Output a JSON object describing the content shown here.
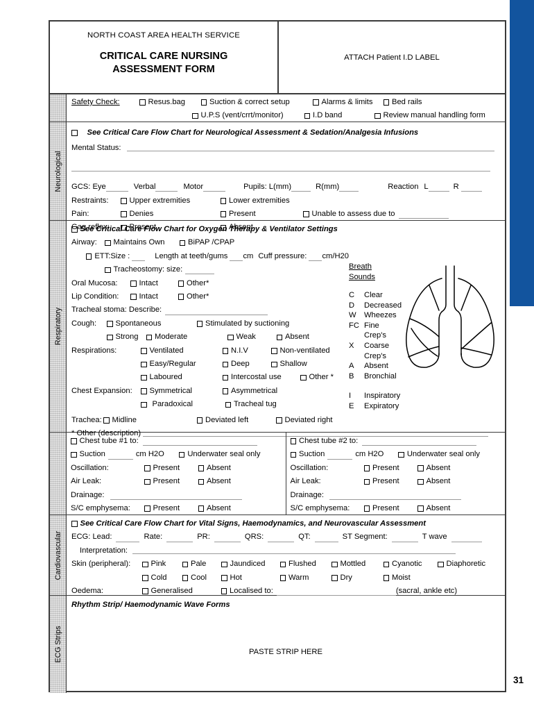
{
  "page": {
    "side_title": "CRITICAL CARE NURSING ASSESSMENT FORM",
    "page_number": "31",
    "accent_color": "#12549e"
  },
  "header": {
    "organisation": "NORTH COAST AREA HEALTH SERVICE",
    "title_line1": "CRITICAL CARE NURSING",
    "title_line2": "ASSESSMENT FORM",
    "attach_label": "ATTACH Patient I.D LABEL"
  },
  "safety": {
    "label": "Safety Check:",
    "row1": [
      "Resus.bag",
      "Suction & correct setup",
      "Alarms & limits",
      "Bed rails"
    ],
    "row2": [
      "U.P.S (vent/crrt/monitor)",
      "I.D band",
      "Review manual handling form"
    ]
  },
  "neurological": {
    "tab_label": "Neurological",
    "flowchart_note": "See Critical Care Flow Chart for Neurological Assessment & Sedation/Analgesia Infusions",
    "mental_status_label": "Mental Status:",
    "gcs_label": "GCS: Eye",
    "gcs_verbal": "Verbal",
    "gcs_motor": "Motor",
    "pupils_label": "Pupils: L(mm)",
    "pupils_r": "R(mm)",
    "reaction_label": "Reaction",
    "reaction_l": "L",
    "reaction_r": "R",
    "restraints_label": "Restraints:",
    "restraints_opts": [
      "Upper extremities",
      "Lower extremities"
    ],
    "pain_label": "Pain:",
    "pain_opts": [
      "Denies",
      "Present",
      "Unable to assess due to"
    ],
    "gag_label": "Gag reflex:",
    "gag_opts": [
      "Present",
      "Absent"
    ]
  },
  "respiratory": {
    "tab_label": "Respiratory",
    "flowchart_note": "See Critical Care Flow Chart for Oxygen Therapy & Ventilator Settings",
    "airway_label": "Airway:",
    "airway_opts": [
      "Maintains Own",
      "BiPAP /CPAP"
    ],
    "ett_label": "ETT:",
    "ett_size_label": "Size :",
    "ett_length_label": "Length at teeth/gums",
    "ett_length_unit": "cm",
    "cuff_label": "Cuff pressure:",
    "cuff_unit": "cm/H20",
    "trach_label": "Tracheostomy: size:",
    "oral_mucosa_label": "Oral Mucosa:",
    "oral_mucosa_opts": [
      "Intact",
      "Other*"
    ],
    "lip_label": "Lip Condition:",
    "lip_opts": [
      "Intact",
      "Other*"
    ],
    "stoma_label": "Tracheal stoma:  Describe:",
    "cough_label": "Cough:",
    "cough_opts": [
      "Spontaneous",
      "Stimulated by suctioning"
    ],
    "cough_strength": [
      "Strong",
      "Moderate",
      "Weak",
      "Absent"
    ],
    "resp_label": "Respirations:",
    "resp_row1": [
      "Ventilated",
      "N.I.V",
      "Non-ventilated"
    ],
    "resp_row2": [
      "Easy/Regular",
      "Deep",
      "Shallow"
    ],
    "resp_row3": [
      "Laboured",
      "Intercostal use",
      "Other *"
    ],
    "chest_exp_label": "Chest Expansion:",
    "chest_exp_row1": [
      "Symmetrical",
      "Asymmetrical"
    ],
    "chest_exp_row2": [
      "Paradoxical",
      "Tracheal tug"
    ],
    "trachea_label": "Trachea:",
    "trachea_opts": [
      "Midline",
      "Deviated left",
      "Deviated right"
    ],
    "other_desc_label": "* Other (description)",
    "breath_sounds": {
      "title_line1": "Breath",
      "title_line2": "Sounds",
      "items": [
        {
          "key": "C",
          "label": "Clear"
        },
        {
          "key": "D",
          "label": "Decreased"
        },
        {
          "key": "W",
          "label": "Wheezes"
        },
        {
          "key": "FC",
          "label": "Fine"
        },
        {
          "key": "",
          "label": "Crep's"
        },
        {
          "key": "X",
          "label": "Coarse"
        },
        {
          "key": "",
          "label": "Crep's"
        },
        {
          "key": "A",
          "label": "Absent"
        },
        {
          "key": "B",
          "label": "Bronchial"
        }
      ],
      "items2": [
        {
          "key": "I",
          "label": "Inspiratory"
        },
        {
          "key": "E",
          "label": "Expiratory"
        }
      ]
    }
  },
  "chest_tubes": [
    {
      "title": "Chest tube #1 to:",
      "suction_label": "Suction",
      "suction_unit": "cm H2O",
      "underwater": "Underwater seal only",
      "oscillation_label": "Oscillation:",
      "oscillation_opts": [
        "Present",
        "Absent"
      ],
      "airleak_label": "Air Leak:",
      "airleak_opts": [
        "Present",
        "Absent"
      ],
      "drainage_label": "Drainage:",
      "emphysema_label": "S/C emphysema:",
      "emphysema_opts": [
        "Present",
        "Absent"
      ]
    },
    {
      "title": "Chest tube #2 to:",
      "suction_label": "Suction",
      "suction_unit": "cm H2O",
      "underwater": "Underwater seal only",
      "oscillation_label": "Oscillation:",
      "oscillation_opts": [
        "Present",
        "Absent"
      ],
      "airleak_label": "Air Leak:",
      "airleak_opts": [
        "Present",
        "Absent"
      ],
      "drainage_label": "Drainage:",
      "emphysema_label": "S/C emphysema:",
      "emphysema_opts": [
        "Present",
        "Absent"
      ]
    }
  ],
  "cardiovascular": {
    "tab_label": "Cardiovascular",
    "flowchart_note": "See Critical Care Flow Chart for Vital Signs, Haemodynamics, and Neurovascular Assessment",
    "ecg_label": "ECG: Lead:",
    "ecg_fields": [
      "Rate:",
      "PR:",
      "QRS:",
      "QT:",
      "ST Segment:",
      "T wave"
    ],
    "interpretation_label": "Interpretation:",
    "skin_label": "Skin (peripheral):",
    "skin_row1": [
      "Pink",
      "Pale",
      "Jaundiced",
      "Flushed",
      "Mottled",
      "Cyanotic",
      "Diaphoretic"
    ],
    "skin_row2": [
      "Cold",
      "Cool",
      "Hot",
      "Warm",
      "Dry",
      "Moist"
    ],
    "oedema_label": "Oedema:",
    "oedema_opts": [
      "Generalised",
      "Localised to:"
    ],
    "oedema_hint": "(sacral, ankle etc)"
  },
  "ecg_strips": {
    "tab_label": "ECG Strips",
    "title": "Rhythm Strip/ Haemodynamic Wave Forms",
    "paste_label": "PASTE STRIP HERE"
  }
}
